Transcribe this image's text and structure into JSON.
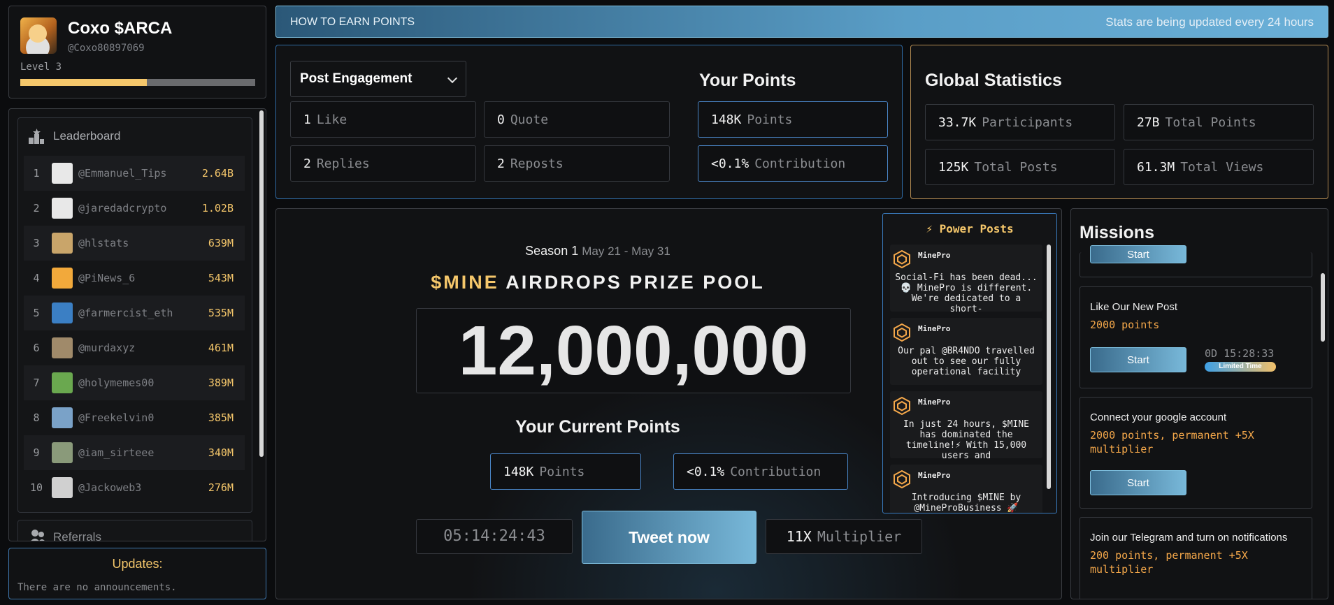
{
  "profile": {
    "name": "Coxo $ARCA",
    "handle": "@Coxo80897069",
    "level": "Level 3",
    "progress": 0.54
  },
  "leaderboard": {
    "title": "Leaderboard",
    "rows": [
      {
        "rank": "1",
        "name": "@Emmanuel_Tips",
        "value": "2.64B"
      },
      {
        "rank": "2",
        "name": "@jaredadcrypto",
        "value": "1.02B"
      },
      {
        "rank": "3",
        "name": "@hlstats",
        "value": "639M"
      },
      {
        "rank": "4",
        "name": "@PiNews_6",
        "value": "543M"
      },
      {
        "rank": "5",
        "name": "@farmercist_eth",
        "value": "535M"
      },
      {
        "rank": "6",
        "name": "@murdaxyz",
        "value": "461M"
      },
      {
        "rank": "7",
        "name": "@holymemes00",
        "value": "389M"
      },
      {
        "rank": "8",
        "name": "@Freekelvin0",
        "value": "385M"
      },
      {
        "rank": "9",
        "name": "@iam_sirteee",
        "value": "340M"
      },
      {
        "rank": "10",
        "name": "@Jackoweb3",
        "value": "276M"
      }
    ],
    "referrals": "Referrals"
  },
  "updates": {
    "title": "Updates:",
    "text": "There are no announcements."
  },
  "banner": {
    "left": "HOW TO EARN POINTS",
    "right": "Stats are being updated every 24 hours"
  },
  "engagement": {
    "selected": "Post Engagement",
    "stats": [
      {
        "num": "1",
        "label": "Like"
      },
      {
        "num": "0",
        "label": "Quote"
      },
      {
        "num": "2",
        "label": "Replies"
      },
      {
        "num": "2",
        "label": "Reposts"
      }
    ],
    "your_points_title": "Your Points",
    "points": {
      "num": "148K",
      "label": "Points"
    },
    "contribution": {
      "num": "<0.1%",
      "label": "Contribution"
    }
  },
  "global": {
    "title": "Global Statistics",
    "stats": [
      {
        "num": "33.7K",
        "label": "Participants"
      },
      {
        "num": "27B",
        "label": "Total Points"
      },
      {
        "num": "125K",
        "label": "Total Posts"
      },
      {
        "num": "61.3M",
        "label": "Total Views"
      }
    ]
  },
  "main": {
    "season": "Season 1",
    "dates": "May 21 - May 31",
    "prize_token": "$MINE",
    "prize_rest": "AIRDROPS PRIZE POOL",
    "amount": "12,000,000",
    "current_title": "Your Current Points",
    "points": {
      "num": "148K",
      "label": "Points"
    },
    "contribution": {
      "num": "<0.1%",
      "label": "Contribution"
    },
    "timer": "05:14:24:43",
    "tweet": "Tweet now",
    "multiplier": {
      "num": "11X",
      "label": "Multiplier"
    }
  },
  "power_posts": {
    "title": "Power Posts",
    "posts": [
      {
        "author": "MinePro",
        "text": "Social-Fi has been dead... 💀 MinePro is different. We're dedicated to a short-"
      },
      {
        "author": "MinePro",
        "text": "Our pal @BR4NDO travelled out to see our fully operational facility"
      },
      {
        "author": "MinePro",
        "text": "In just 24 hours, $MINE has dominated the timeline!⚡ With 15,000 users and"
      },
      {
        "author": "MinePro",
        "text": "Introducing $MINE by @MineProBusiness 🚀"
      }
    ]
  },
  "missions": {
    "title": "Missions",
    "start": "Start",
    "items": [
      {
        "title": "Like Our New Post",
        "points": "2000 points",
        "countdown": "0D 15:28:33",
        "tag": "Limited Time"
      },
      {
        "title": "Connect your google account",
        "points": "2000 points, permanent +5X multiplier"
      },
      {
        "title": "Join our Telegram and turn on notifications",
        "points": "200 points, permanent +5X multiplier"
      }
    ]
  },
  "colors": {
    "accent": "#f5c76b",
    "blue": "#4a8fd6",
    "orange": "#f5a84a"
  }
}
